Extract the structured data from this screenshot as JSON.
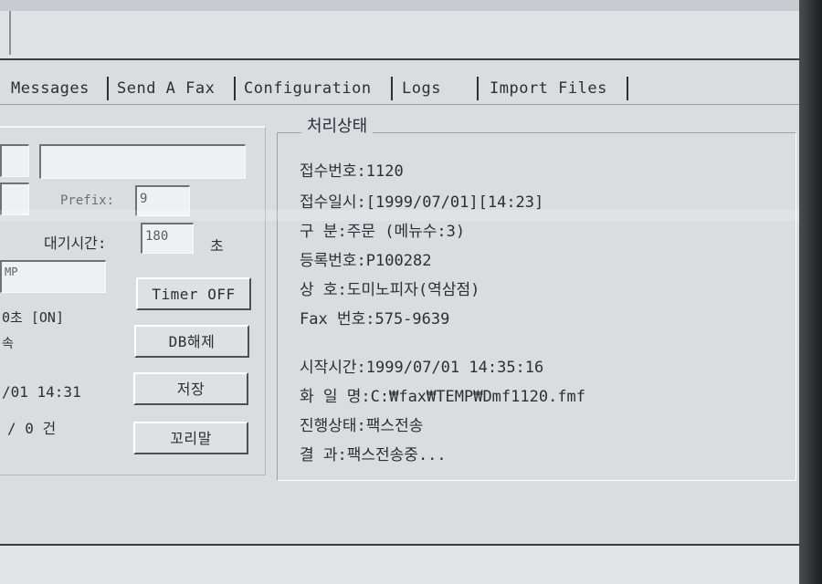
{
  "tabs": [
    "Messages",
    "Send A Fax",
    "Configuration",
    "Logs",
    "Import Files"
  ],
  "left_panel": {
    "prefix_label": "Prefix:",
    "prefix_value": "9",
    "wait_label": "대기시간:",
    "wait_value": "180",
    "wait_unit": "초",
    "path_fragment": "MP",
    "status_fragment": "0초  [ON]",
    "status_fragment2": "속",
    "time_fragment": "/01 14:31",
    "count_fragment": "/      0 건",
    "buttons": {
      "timer": "Timer OFF",
      "db_release": "DB해제",
      "save": "저장",
      "tail": "꼬리말"
    }
  },
  "status_panel": {
    "title": "처리상태",
    "rows": [
      {
        "key": "접수번호:",
        "value": "1120"
      },
      {
        "key": "접수일시:",
        "value": "[1999/07/01][14:23]"
      },
      {
        "key": "구    분:",
        "value": "주문 (메뉴수:3)"
      },
      {
        "key": "등록번호:",
        "value": "P100282"
      },
      {
        "key": "상    호:",
        "value": "도미노피자(역삼점)"
      },
      {
        "key": "Fax 번호:",
        "value": "575-9639"
      },
      {
        "key": "시작시간:",
        "value": "1999/07/01 14:35:16"
      },
      {
        "key": "화 일 명:",
        "value": "C:₩fax₩TEMP₩Dmf1120.fmf"
      },
      {
        "key": "진행상태:",
        "value": "팩스전송"
      },
      {
        "key": "결    과:",
        "value": "팩스전송중..."
      }
    ]
  },
  "colors": {
    "window_bg": "#d9dde0",
    "text": "#2b2f36",
    "field_bg": "#eef1f3"
  }
}
